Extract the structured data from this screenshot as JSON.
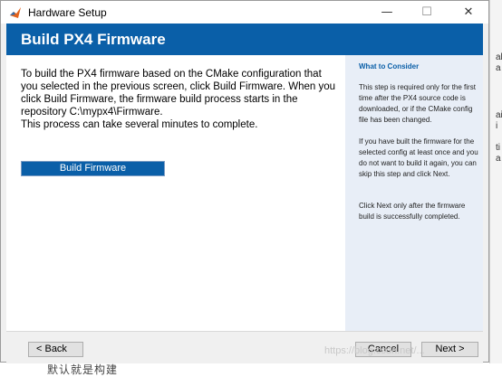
{
  "window": {
    "title": "Hardware Setup",
    "min_glyph": "—",
    "max_glyph": "☐",
    "close_glyph": "✕",
    "app_icon": "matlab-logo-icon"
  },
  "header": {
    "title": "Build PX4 Firmware",
    "band_color": "#0a5fa8"
  },
  "main": {
    "instructions": [
      "To build the PX4 firmware based on the CMake configuration that you selected in the previous screen, click Build Firmware. When you click Build Firmware, the firmware build process starts in the repository C:\\mypx4\\Firmware.",
      "This process can take several minutes to complete."
    ],
    "build_button_label": "Build Firmware"
  },
  "sidebar": {
    "heading": "What to Consider",
    "paragraphs": [
      "This step is required only for the first time after the PX4 source code is downloaded, or if the CMake config file has been changed.",
      "If you have built the firmware for the selected config at least once and you do not want to build it again, you can skip this step and click Next.",
      "Click Next only after the firmware build is successfully completed."
    ]
  },
  "footer": {
    "back_label": "< Back",
    "cancel_label": "Cancel",
    "next_label": "Next >"
  },
  "watermark": "https://blog.csdn.net/...",
  "background": {
    "bottom_text": "默认就是构建",
    "right_edge_chars": [
      "al",
      "a",
      "ai",
      "i",
      "ti",
      "a"
    ]
  }
}
